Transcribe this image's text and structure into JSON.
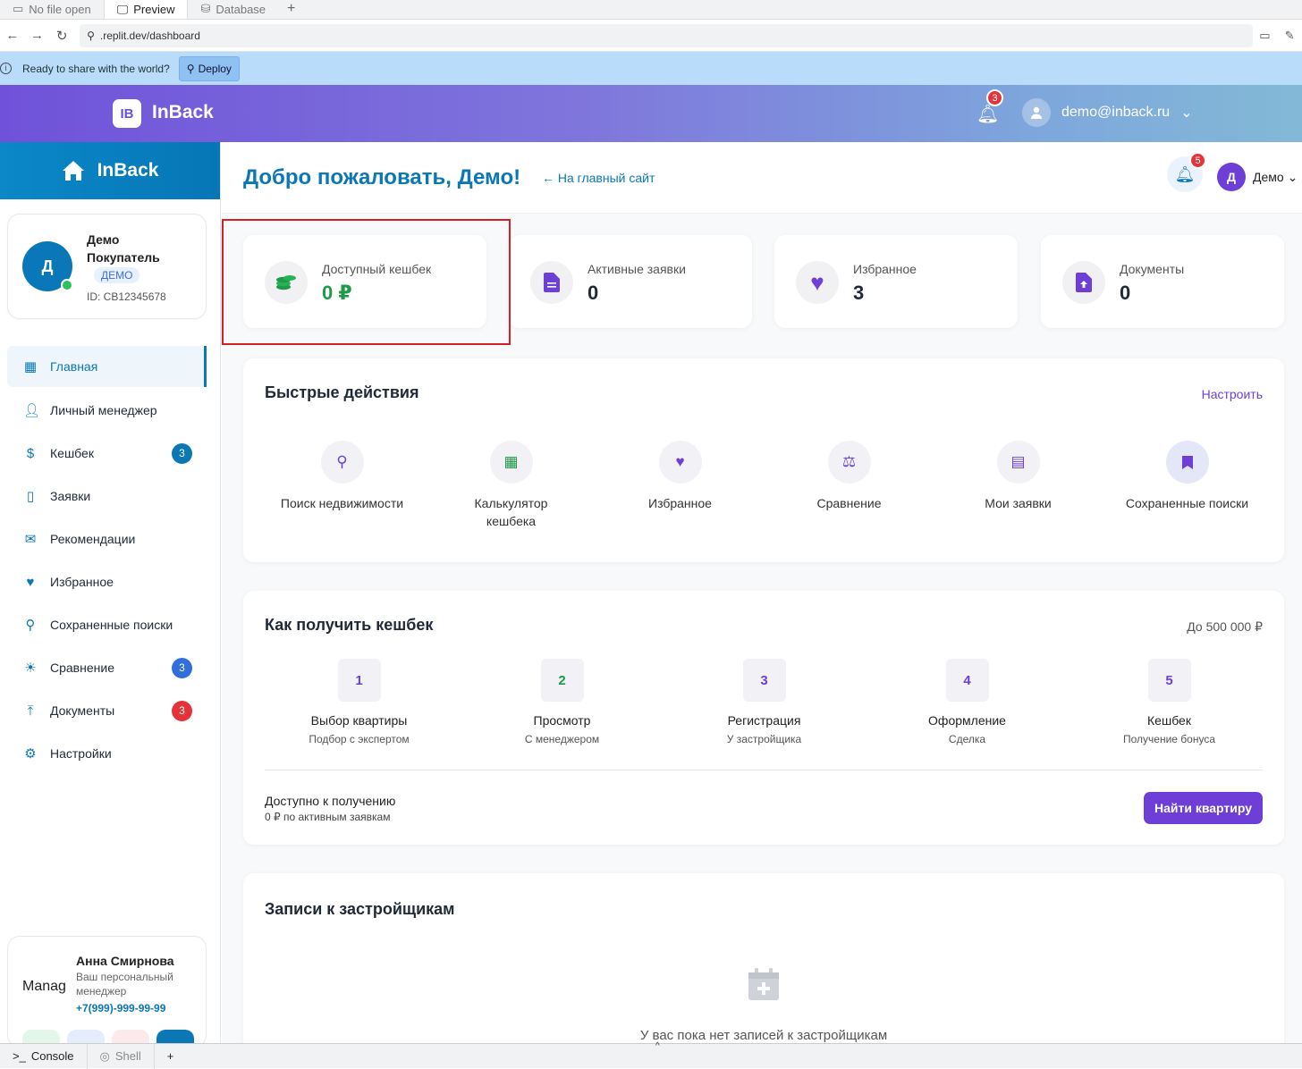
{
  "browser": {
    "tabs": [
      "No file open",
      "Preview",
      "Database",
      "+"
    ],
    "url": ".replit.dev/dashboard",
    "share_text": "Ready to share with the world?",
    "deploy_label": "Deploy"
  },
  "topbar": {
    "logo_mark": "IB",
    "logo_text": "InBack",
    "notif_count": "3",
    "user_email": "demo@inback.ru"
  },
  "sidebar": {
    "brand": "InBack",
    "profile": {
      "initial": "Д",
      "name": "Демо Покупатель",
      "tag": "ДЕМО",
      "id": "ID: CB12345678"
    },
    "items": [
      {
        "label": "Главная",
        "icon": "dashboard-icon"
      },
      {
        "label": "Личный менеджер",
        "icon": "user-icon"
      },
      {
        "label": "Кешбек",
        "icon": "dollar-icon",
        "badge": "3"
      },
      {
        "label": "Заявки",
        "icon": "phone-icon"
      },
      {
        "label": "Рекомендации",
        "icon": "mail-icon"
      },
      {
        "label": "Избранное",
        "icon": "heart-icon"
      },
      {
        "label": "Сохраненные поиски",
        "icon": "search-icon"
      },
      {
        "label": "Сравнение",
        "icon": "sun-icon",
        "badge": "3"
      },
      {
        "label": "Документы",
        "icon": "upload-icon",
        "badge": "3"
      },
      {
        "label": "Настройки",
        "icon": "gear-icon"
      }
    ],
    "manager": {
      "avatar_alt": "Manag",
      "name": "Анна Смирнова",
      "role": "Ваш персональный менеджер",
      "phone": "+7(999)-999-99-99"
    }
  },
  "main": {
    "welcome": "Добро пожаловать, Демо!",
    "back_link": "На главный сайт",
    "notif_count": "5",
    "user_initial": "Д",
    "user_name": "Демо",
    "stats": [
      {
        "label": "Доступный кешбек",
        "value": "0 ₽",
        "icon": "coins-icon"
      },
      {
        "label": "Активные заявки",
        "value": "0",
        "icon": "file-icon"
      },
      {
        "label": "Избранное",
        "value": "3",
        "icon": "heart-icon"
      },
      {
        "label": "Документы",
        "value": "0",
        "icon": "file-upload-icon"
      }
    ],
    "quick": {
      "title": "Быстрые действия",
      "link": "Настроить",
      "items": [
        {
          "label": "Поиск недвижимости",
          "icon": "search-icon"
        },
        {
          "label": "Калькулятор кешбека",
          "icon": "calculator-icon"
        },
        {
          "label": "Избранное",
          "icon": "heart-icon"
        },
        {
          "label": "Сравнение",
          "icon": "scales-icon"
        },
        {
          "label": "Мои заявки",
          "icon": "file-icon"
        },
        {
          "label": "Сохраненные поиски",
          "icon": "bookmark-icon"
        }
      ]
    },
    "cashback": {
      "title": "Как получить кешбек",
      "limit": "До 500 000 ₽",
      "steps": [
        {
          "n": "1",
          "title": "Выбор квартиры",
          "sub": "Подбор с экспертом"
        },
        {
          "n": "2",
          "title": "Просмотр",
          "sub": "С менеджером"
        },
        {
          "n": "3",
          "title": "Регистрация",
          "sub": "У застройщика"
        },
        {
          "n": "4",
          "title": "Оформление",
          "sub": "Сделка"
        },
        {
          "n": "5",
          "title": "Кешбек",
          "sub": "Получение бонуса"
        }
      ],
      "available_title": "Доступно к получению",
      "available_sub": "0 ₽ по активным заявкам",
      "button": "Найти квартиру"
    },
    "appointments": {
      "title": "Записи к застройщикам",
      "empty": "У вас пока нет записей к застройщикам"
    }
  },
  "bottom": {
    "tabs": [
      "Console",
      "Shell",
      "+"
    ]
  },
  "colors": {
    "brand_blue": "#0b78b5",
    "accent_purple": "#6d3fd6",
    "badge_red": "#e5333b",
    "green": "#1f9a4a"
  }
}
